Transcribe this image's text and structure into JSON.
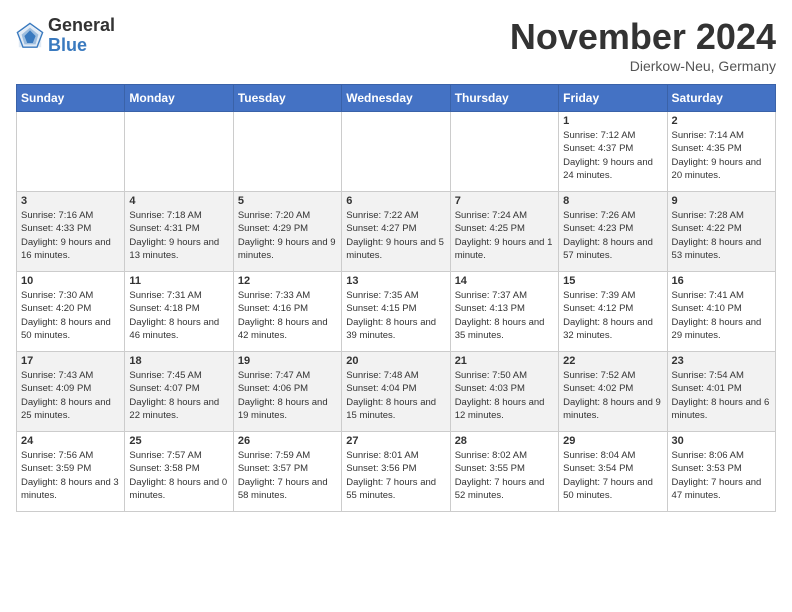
{
  "logo": {
    "general": "General",
    "blue": "Blue"
  },
  "title": "November 2024",
  "location": "Dierkow-Neu, Germany",
  "days_of_week": [
    "Sunday",
    "Monday",
    "Tuesday",
    "Wednesday",
    "Thursday",
    "Friday",
    "Saturday"
  ],
  "weeks": [
    [
      {
        "day": "",
        "info": ""
      },
      {
        "day": "",
        "info": ""
      },
      {
        "day": "",
        "info": ""
      },
      {
        "day": "",
        "info": ""
      },
      {
        "day": "",
        "info": ""
      },
      {
        "day": "1",
        "info": "Sunrise: 7:12 AM\nSunset: 4:37 PM\nDaylight: 9 hours and 24 minutes."
      },
      {
        "day": "2",
        "info": "Sunrise: 7:14 AM\nSunset: 4:35 PM\nDaylight: 9 hours and 20 minutes."
      }
    ],
    [
      {
        "day": "3",
        "info": "Sunrise: 7:16 AM\nSunset: 4:33 PM\nDaylight: 9 hours and 16 minutes."
      },
      {
        "day": "4",
        "info": "Sunrise: 7:18 AM\nSunset: 4:31 PM\nDaylight: 9 hours and 13 minutes."
      },
      {
        "day": "5",
        "info": "Sunrise: 7:20 AM\nSunset: 4:29 PM\nDaylight: 9 hours and 9 minutes."
      },
      {
        "day": "6",
        "info": "Sunrise: 7:22 AM\nSunset: 4:27 PM\nDaylight: 9 hours and 5 minutes."
      },
      {
        "day": "7",
        "info": "Sunrise: 7:24 AM\nSunset: 4:25 PM\nDaylight: 9 hours and 1 minute."
      },
      {
        "day": "8",
        "info": "Sunrise: 7:26 AM\nSunset: 4:23 PM\nDaylight: 8 hours and 57 minutes."
      },
      {
        "day": "9",
        "info": "Sunrise: 7:28 AM\nSunset: 4:22 PM\nDaylight: 8 hours and 53 minutes."
      }
    ],
    [
      {
        "day": "10",
        "info": "Sunrise: 7:30 AM\nSunset: 4:20 PM\nDaylight: 8 hours and 50 minutes."
      },
      {
        "day": "11",
        "info": "Sunrise: 7:31 AM\nSunset: 4:18 PM\nDaylight: 8 hours and 46 minutes."
      },
      {
        "day": "12",
        "info": "Sunrise: 7:33 AM\nSunset: 4:16 PM\nDaylight: 8 hours and 42 minutes."
      },
      {
        "day": "13",
        "info": "Sunrise: 7:35 AM\nSunset: 4:15 PM\nDaylight: 8 hours and 39 minutes."
      },
      {
        "day": "14",
        "info": "Sunrise: 7:37 AM\nSunset: 4:13 PM\nDaylight: 8 hours and 35 minutes."
      },
      {
        "day": "15",
        "info": "Sunrise: 7:39 AM\nSunset: 4:12 PM\nDaylight: 8 hours and 32 minutes."
      },
      {
        "day": "16",
        "info": "Sunrise: 7:41 AM\nSunset: 4:10 PM\nDaylight: 8 hours and 29 minutes."
      }
    ],
    [
      {
        "day": "17",
        "info": "Sunrise: 7:43 AM\nSunset: 4:09 PM\nDaylight: 8 hours and 25 minutes."
      },
      {
        "day": "18",
        "info": "Sunrise: 7:45 AM\nSunset: 4:07 PM\nDaylight: 8 hours and 22 minutes."
      },
      {
        "day": "19",
        "info": "Sunrise: 7:47 AM\nSunset: 4:06 PM\nDaylight: 8 hours and 19 minutes."
      },
      {
        "day": "20",
        "info": "Sunrise: 7:48 AM\nSunset: 4:04 PM\nDaylight: 8 hours and 15 minutes."
      },
      {
        "day": "21",
        "info": "Sunrise: 7:50 AM\nSunset: 4:03 PM\nDaylight: 8 hours and 12 minutes."
      },
      {
        "day": "22",
        "info": "Sunrise: 7:52 AM\nSunset: 4:02 PM\nDaylight: 8 hours and 9 minutes."
      },
      {
        "day": "23",
        "info": "Sunrise: 7:54 AM\nSunset: 4:01 PM\nDaylight: 8 hours and 6 minutes."
      }
    ],
    [
      {
        "day": "24",
        "info": "Sunrise: 7:56 AM\nSunset: 3:59 PM\nDaylight: 8 hours and 3 minutes."
      },
      {
        "day": "25",
        "info": "Sunrise: 7:57 AM\nSunset: 3:58 PM\nDaylight: 8 hours and 0 minutes."
      },
      {
        "day": "26",
        "info": "Sunrise: 7:59 AM\nSunset: 3:57 PM\nDaylight: 7 hours and 58 minutes."
      },
      {
        "day": "27",
        "info": "Sunrise: 8:01 AM\nSunset: 3:56 PM\nDaylight: 7 hours and 55 minutes."
      },
      {
        "day": "28",
        "info": "Sunrise: 8:02 AM\nSunset: 3:55 PM\nDaylight: 7 hours and 52 minutes."
      },
      {
        "day": "29",
        "info": "Sunrise: 8:04 AM\nSunset: 3:54 PM\nDaylight: 7 hours and 50 minutes."
      },
      {
        "day": "30",
        "info": "Sunrise: 8:06 AM\nSunset: 3:53 PM\nDaylight: 7 hours and 47 minutes."
      }
    ]
  ]
}
